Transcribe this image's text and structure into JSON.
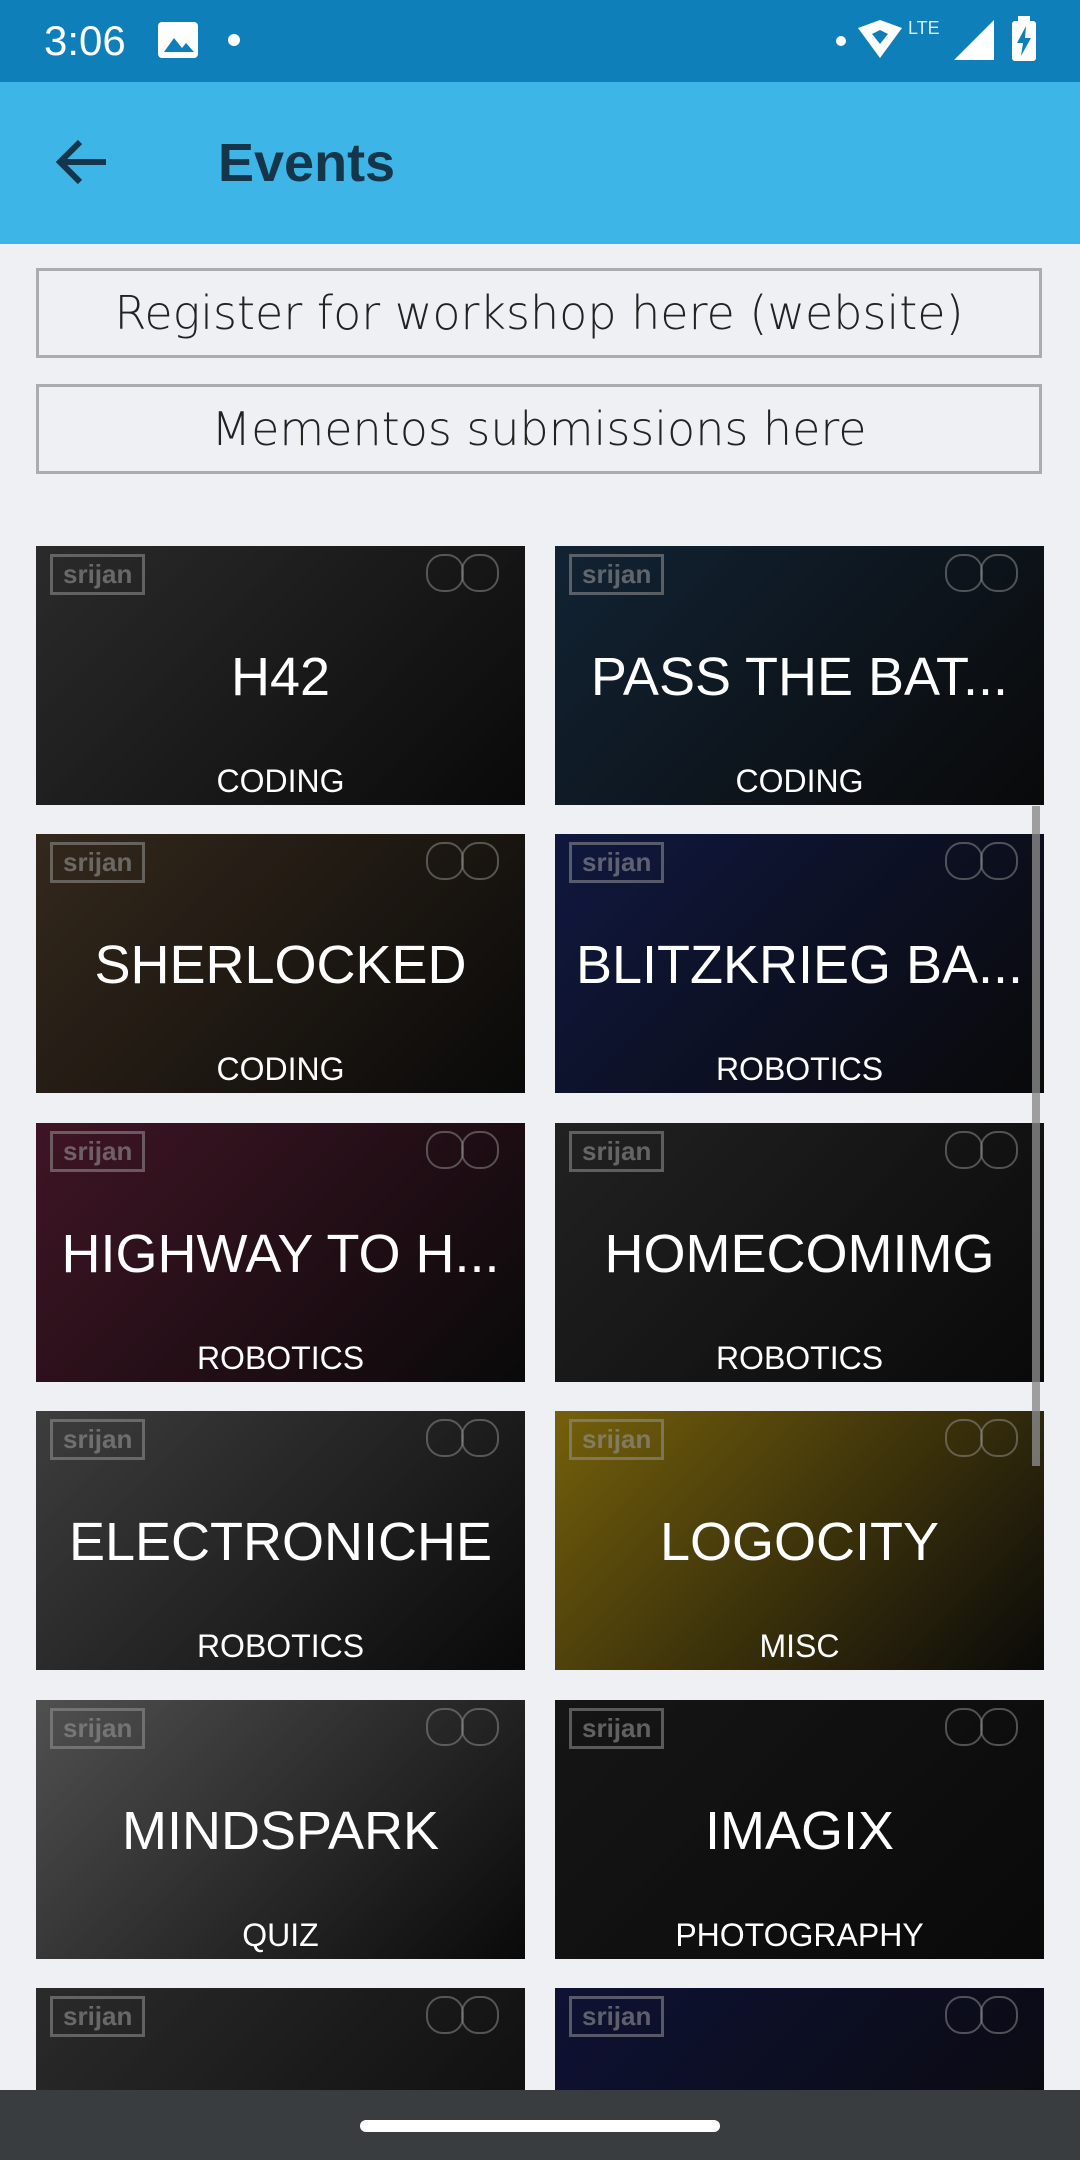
{
  "status_bar": {
    "time": "3:06",
    "network": "LTE"
  },
  "app_bar": {
    "title": "Events"
  },
  "buttons": {
    "workshop": "Register for workshop here (website)",
    "mementos": "Mementos submissions here"
  },
  "events": [
    {
      "name": "H42",
      "category": "CODING",
      "color": "#4a4a4a"
    },
    {
      "name": "PASS THE BAT...",
      "category": "CODING",
      "color": "#1f3d5a"
    },
    {
      "name": "SHERLOCKED",
      "category": "CODING",
      "color": "#5a4630"
    },
    {
      "name": "BLITZKRIEG BA...",
      "category": "ROBOTICS",
      "color": "#1c2a6e"
    },
    {
      "name": "HIGHWAY TO H...",
      "category": "ROBOTICS",
      "color": "#6e2440"
    },
    {
      "name": "HOMECOMIMG",
      "category": "ROBOTICS",
      "color": "#3a3a3a"
    },
    {
      "name": "ELECTRONICHE",
      "category": "ROBOTICS",
      "color": "#6a6a6a"
    },
    {
      "name": "LOGOCITY",
      "category": "MISC",
      "color": "#c9a614"
    },
    {
      "name": "MINDSPARK",
      "category": "QUIZ",
      "color": "#8a8a8a"
    },
    {
      "name": "IMAGIX",
      "category": "PHOTOGRAPHY",
      "color": "#262626"
    },
    {
      "name": "",
      "category": "",
      "color": "#4a4a4a"
    },
    {
      "name": "",
      "category": "",
      "color": "#1a1f5a"
    }
  ],
  "tile_brand": "srijan"
}
